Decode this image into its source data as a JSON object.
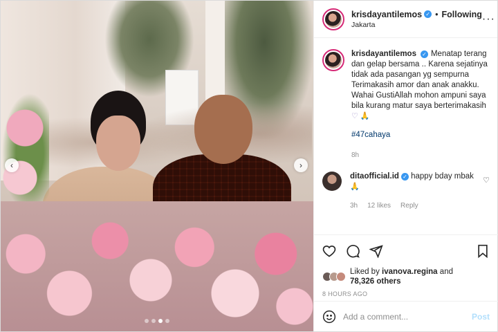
{
  "post": {
    "username": "krisdayantilemos",
    "follow_label": "Following",
    "separator": "•",
    "location": "Jakarta",
    "more_label": "···"
  },
  "caption": {
    "username": "krisdayantilemos",
    "text": "Menatap terang dan gelap bersama .. Karena sejatinya tidak ada pasangan yg sempurna Terimakasih amor dan anak anakku. Wahai GustiAllah mohon ampuni saya bila kurang matur saya berterimakasih",
    "emojis": "♡ 🙏",
    "hashtag": "#47cahaya",
    "time": "8h"
  },
  "reply": {
    "username": "ditaofficial.id",
    "text": "happy bday mbak",
    "emoji": "🙏",
    "time": "3h",
    "likes": "12 likes",
    "reply_label": "Reply"
  },
  "likes": {
    "prefix": "Liked by",
    "user": "ivanova.regina",
    "and": "and",
    "others": "78,326 others"
  },
  "timestamp": "8 HOURS AGO",
  "comment_box": {
    "placeholder": "Add a comment...",
    "post_label": "Post"
  },
  "carousel": {
    "prev": "‹",
    "next": "›",
    "slides": 4,
    "active": 2
  },
  "icons": {
    "verified": "verified-badge-icon",
    "heart": "heart-icon",
    "comment": "comment-icon",
    "share": "share-icon",
    "save": "bookmark-icon",
    "emoji": "smile-icon"
  },
  "colors": {
    "link": "#00376b",
    "verified": "#3897f0",
    "post_disabled": "#b2dffc",
    "meta": "#8e8e8e"
  }
}
